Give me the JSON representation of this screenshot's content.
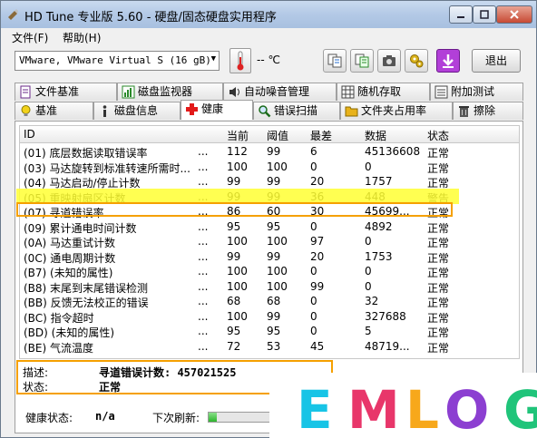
{
  "window": {
    "title": "HD Tune 专业版 5.60 - 硬盘/固态硬盘实用程序"
  },
  "menu": [
    {
      "label": "文件(F)"
    },
    {
      "label": "帮助(H)"
    }
  ],
  "toolbar": {
    "drive": "VMware, VMware Virtual S (16 gB)",
    "temperature": "-- ℃",
    "exit_label": "退出"
  },
  "tabs_top": [
    {
      "label": "文件基准",
      "icon": "document-icon"
    },
    {
      "label": "磁盘监视器",
      "icon": "chart-icon"
    },
    {
      "label": "自动噪音管理",
      "icon": "speaker-icon"
    },
    {
      "label": "随机存取",
      "icon": "grid-icon"
    },
    {
      "label": "附加测试",
      "icon": "list-icon"
    }
  ],
  "tabs_bottom": [
    {
      "label": "基准",
      "icon": "bulb-icon"
    },
    {
      "label": "磁盘信息",
      "icon": "info-icon"
    },
    {
      "label": "健康",
      "icon": "health-cross-icon",
      "active": true
    },
    {
      "label": "错误扫描",
      "icon": "magnifier-icon"
    },
    {
      "label": "文件夹占用率",
      "icon": "folder-icon"
    },
    {
      "label": "擦除",
      "icon": "trash-icon"
    }
  ],
  "table": {
    "columns": [
      "ID",
      "当前",
      "阈值",
      "最差",
      "数据",
      "状态"
    ],
    "rows": [
      {
        "id": "(01) 底层数据读取错误率",
        "dots": "...",
        "cur": "112",
        "thr": "99",
        "worst": "6",
        "data": "45136608",
        "status": "正常"
      },
      {
        "id": "(03) 马达旋转到标准转速所需时...",
        "dots": "...",
        "cur": "100",
        "thr": "100",
        "worst": "0",
        "data": "0",
        "status": "正常"
      },
      {
        "id": "(04) 马达启动/停止计数",
        "dots": "...",
        "cur": "99",
        "thr": "99",
        "worst": "20",
        "data": "1757",
        "status": "正常"
      },
      {
        "id": "(05) 重映射扇区计数",
        "dots": "...",
        "cur": "99",
        "thr": "99",
        "worst": "36",
        "data": "448",
        "status": "警告"
      },
      {
        "id": "(07) 寻道错误率",
        "dots": "...",
        "cur": "86",
        "thr": "60",
        "worst": "30",
        "data": "45699...",
        "status": "正常"
      },
      {
        "id": "(09) 累计通电时间计数",
        "dots": "...",
        "cur": "95",
        "thr": "95",
        "worst": "0",
        "data": "4892",
        "status": "正常"
      },
      {
        "id": "(0A) 马达重试计数",
        "dots": "...",
        "cur": "100",
        "thr": "100",
        "worst": "97",
        "data": "0",
        "status": "正常"
      },
      {
        "id": "(0C) 通电周期计数",
        "dots": "...",
        "cur": "99",
        "thr": "99",
        "worst": "20",
        "data": "1753",
        "status": "正常"
      },
      {
        "id": "(B7) (未知的属性)",
        "dots": "...",
        "cur": "100",
        "thr": "100",
        "worst": "0",
        "data": "0",
        "status": "正常"
      },
      {
        "id": "(B8) 末尾到末尾错误检测",
        "dots": "...",
        "cur": "100",
        "thr": "100",
        "worst": "99",
        "data": "0",
        "status": "正常"
      },
      {
        "id": "(BB) 反馈无法校正的错误",
        "dots": "...",
        "cur": "68",
        "thr": "68",
        "worst": "0",
        "data": "32",
        "status": "正常"
      },
      {
        "id": "(BC) 指令超时",
        "dots": "...",
        "cur": "100",
        "thr": "99",
        "worst": "0",
        "data": "327688",
        "status": "正常"
      },
      {
        "id": "(BD) (未知的属性)",
        "dots": "...",
        "cur": "95",
        "thr": "95",
        "worst": "0",
        "data": "5",
        "status": "正常"
      },
      {
        "id": "(BE) 气流温度",
        "dots": "...",
        "cur": "72",
        "thr": "53",
        "worst": "45",
        "data": "48719...",
        "status": "正常"
      }
    ]
  },
  "details": {
    "desc_label": "描述:",
    "desc_value": "寻道错误计数: 457021525",
    "status_label": "状态:",
    "status_value": "正常"
  },
  "footer": {
    "health_label": "健康状态:",
    "health_value": "n/a",
    "refresh_label": "下次刷新:",
    "refresh_progress": 0.12
  },
  "watermark": {
    "text": "EMLOG",
    "letters": [
      {
        "ch": "E",
        "color": "#17c4e6"
      },
      {
        "ch": "M",
        "color": "#e8366a"
      },
      {
        "ch": "L",
        "color": "#f7a81b"
      },
      {
        "ch": "O",
        "color": "#8c3fd1"
      },
      {
        "ch": "G",
        "color": "#20c47a"
      }
    ]
  }
}
